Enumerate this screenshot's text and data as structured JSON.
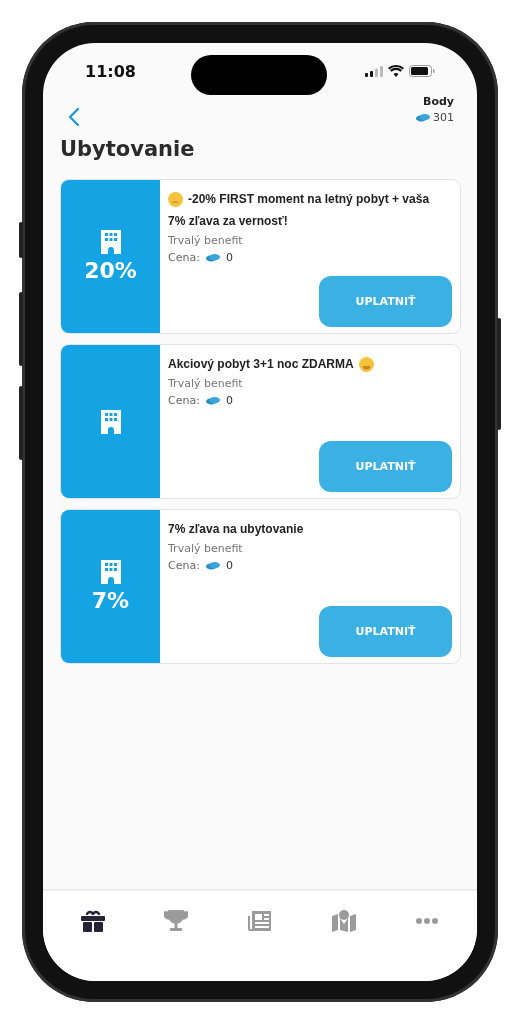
{
  "status_bar": {
    "time": "11:08"
  },
  "header": {
    "points_label": "Body",
    "points": "301"
  },
  "title": "Ubytovanie",
  "offers": [
    {
      "badge": "20%",
      "emoji_before": true,
      "title_lines": [
        "-20% FIRST moment na letný pobyt + vaša",
        "7% zľava za vernosť!"
      ],
      "subtitle": "Trvalý benefit",
      "price_label": "Cena:",
      "price": "0",
      "button": "UPLATNIŤ"
    },
    {
      "emoji_after": true,
      "title_lines": [
        "Akciový pobyt 3+1 noc ZDARMA"
      ],
      "subtitle": "Trvalý benefit",
      "price_label": "Cena:",
      "price": "0",
      "button": "UPLATNIŤ"
    },
    {
      "badge": "7%",
      "title_lines": [
        "7% zľava na ubytovanie"
      ],
      "subtitle": "Trvalý benefit",
      "price_label": "Cena:",
      "price": "0",
      "button": "UPLATNIŤ"
    }
  ],
  "tabs": [
    {
      "kind": "gift",
      "selected": true
    },
    {
      "kind": "trophy",
      "selected": false
    },
    {
      "kind": "news",
      "selected": false
    },
    {
      "kind": "map",
      "selected": false
    },
    {
      "kind": "more",
      "selected": false
    }
  ]
}
